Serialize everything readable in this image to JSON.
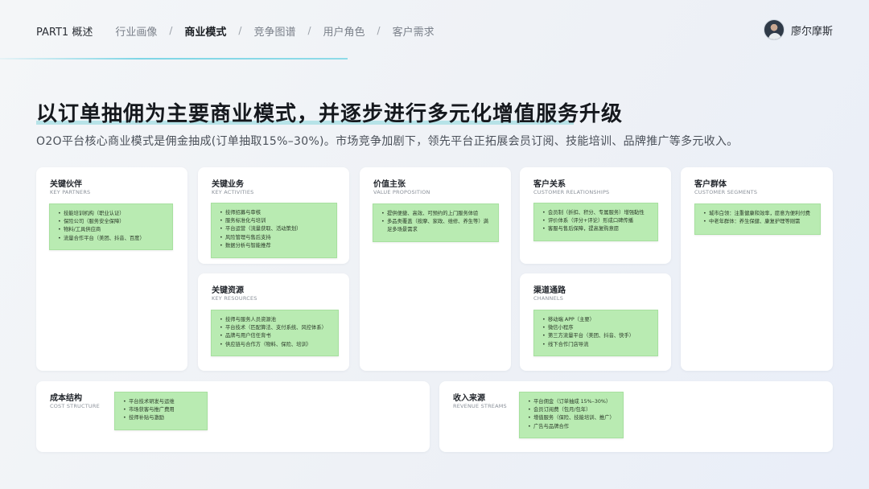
{
  "nav": {
    "part": "PART1 概述",
    "items": [
      "行业画像",
      "商业模式",
      "竞争图谱",
      "用户角色",
      "客户需求"
    ],
    "separator": "/"
  },
  "user": {
    "name": "廖尔摩斯"
  },
  "title": "以订单抽佣为主要商业模式，并逐步进行多元化增值服务升级",
  "subtitle": "O2O平台核心商业模式是佣金抽成(订单抽取15%–30%)。市场竞争加剧下，领先平台正拓展会员订阅、技能培训、品牌推广等多元收入。",
  "cards": {
    "key_partners": {
      "title": "关键伙伴",
      "sub": "KEY PARTNERS",
      "items": [
        "技能培训机构（职业认证）",
        "保险公司（服务安全保障）",
        "物料/工具供应商",
        "流量合作平台（美团、抖音、百度）"
      ]
    },
    "key_activities": {
      "title": "关键业务",
      "sub": "KEY ACTIVITIES",
      "items": [
        "技师招募与审核",
        "服务标准化与培训",
        "平台运营（流量获取、活动策划）",
        "风险管理与售后支持",
        "数据分析与智能推荐"
      ]
    },
    "key_resources": {
      "title": "关键资源",
      "sub": "KEY RESOURCES",
      "items": [
        "技师与服务人员资源池",
        "平台技术（匹配算法、支付系统、风控体系）",
        "品牌与用户信任背书",
        "供应链与合作方（物料、保险、培训）"
      ]
    },
    "value_proposition": {
      "title": "价值主张",
      "sub": "VALUE PROPOSITION",
      "items": [
        "提供便捷、高效、可预约的上门服务体验",
        "多品类覆盖（按摩、家政、维修、养生等）满足多场景需求"
      ]
    },
    "customer_relationships": {
      "title": "客户关系",
      "sub": "CUSTOMER RELATIONSHIPS",
      "items": [
        "会员制（折扣、积分、专属服务）增强黏性",
        "评价体系（评分+评论）形成口碑传播",
        "客服与售后保障，提高复购意愿"
      ]
    },
    "channels": {
      "title": "渠道通路",
      "sub": "CHANNELS",
      "items": [
        "移动端 APP（主要）",
        "微信小程序",
        "第三方流量平台（美团、抖音、快手）",
        "线下合作门店导流"
      ]
    },
    "customer_segments": {
      "title": "客户群体",
      "sub": "CUSTOMER SEGMENTS",
      "items": [
        "城市白领：注重健康和效率，愿意为便利付费",
        "中老年群体：养生保健、康复护理等刚需"
      ]
    },
    "cost_structure": {
      "title": "成本结构",
      "sub": "COST STRUCTURE",
      "items": [
        "平台技术研发与运维",
        "市场获客与推广费用",
        "技师补贴与激励"
      ]
    },
    "revenue_streams": {
      "title": "收入来源",
      "sub": "REVENUE STREAMS",
      "items": [
        "平台佣金（订单抽成 15%–30%）",
        "会员订阅费（包月/包年）",
        "增值服务（保险、技能培训、推广）",
        "广告与品牌合作"
      ]
    }
  }
}
